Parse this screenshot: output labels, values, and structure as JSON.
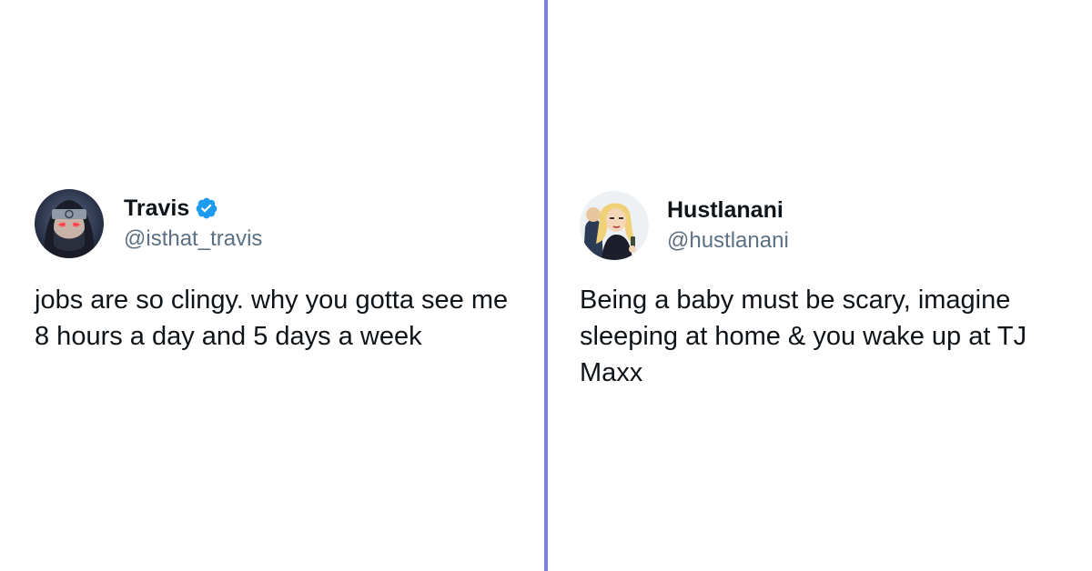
{
  "colors": {
    "divider": "#7b7ee3",
    "verified_badge": "#1d9bf0",
    "handle_text": "#5b7083",
    "body_text": "#0f1419"
  },
  "tweets": [
    {
      "display_name": "Travis",
      "verified": true,
      "handle": "@isthat_travis",
      "avatar_icon": "ninja-avatar",
      "text": "jobs are so clingy. why you gotta see me 8 hours a day and 5 days a week"
    },
    {
      "display_name": "Hustlanani",
      "verified": false,
      "handle": "@hustlanani",
      "avatar_icon": "cartoon-avatar",
      "text": "Being a baby must be scary, imagine sleeping at home & you wake up at TJ Maxx"
    }
  ]
}
